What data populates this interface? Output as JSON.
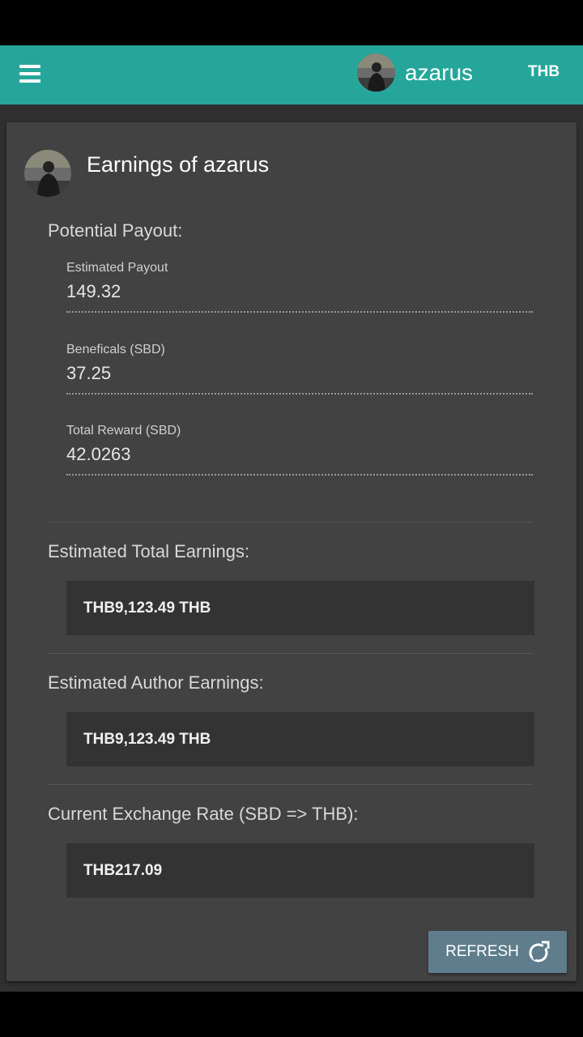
{
  "header": {
    "username": "azarus",
    "currency": "THB"
  },
  "card": {
    "title": "Earnings of azarus",
    "potential_payout": {
      "label": "Potential Payout:",
      "fields": [
        {
          "label": "Estimated Payout",
          "value": "149.32"
        },
        {
          "label": "Beneficals (SBD)",
          "value": "37.25"
        },
        {
          "label": "Total Reward (SBD)",
          "value": "42.0263"
        }
      ]
    },
    "estimated_total": {
      "label": "Estimated Total Earnings:",
      "value": "THB9,123.49 THB"
    },
    "estimated_author": {
      "label": "Estimated Author Earnings:",
      "value": "THB9,123.49 THB"
    },
    "exchange_rate": {
      "label": "Current Exchange Rate (SBD => THB):",
      "value": "THB217.09"
    },
    "refresh_label": "REFRESH"
  },
  "colors": {
    "topbar": "#26a69a",
    "card": "#424242",
    "button": "#5f7d8c"
  }
}
